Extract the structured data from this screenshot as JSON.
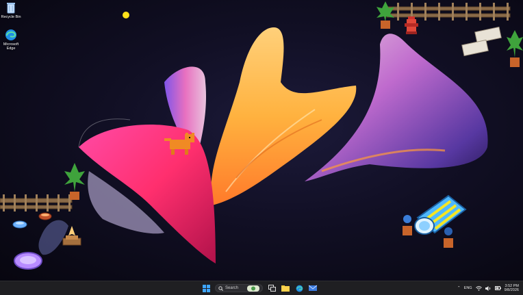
{
  "desktop": {
    "icons": [
      {
        "label": "Recycle Bin",
        "icon": "recycle-bin-icon"
      },
      {
        "label": "Microsoft Edge",
        "icon": "edge-icon"
      }
    ]
  },
  "taskbar": {
    "search_label": "Search",
    "apps": [
      "start-icon",
      "search-icon",
      "widget-icon",
      "task-view-icon",
      "file-explorer-icon",
      "edge-icon",
      "mail-icon"
    ],
    "tray": {
      "language": "ENG",
      "time": "3:52 PM",
      "date": "9/8/2026"
    }
  },
  "colors": {
    "taskbar": "#1f1f22",
    "accent_blue": "#3ea6ff"
  }
}
